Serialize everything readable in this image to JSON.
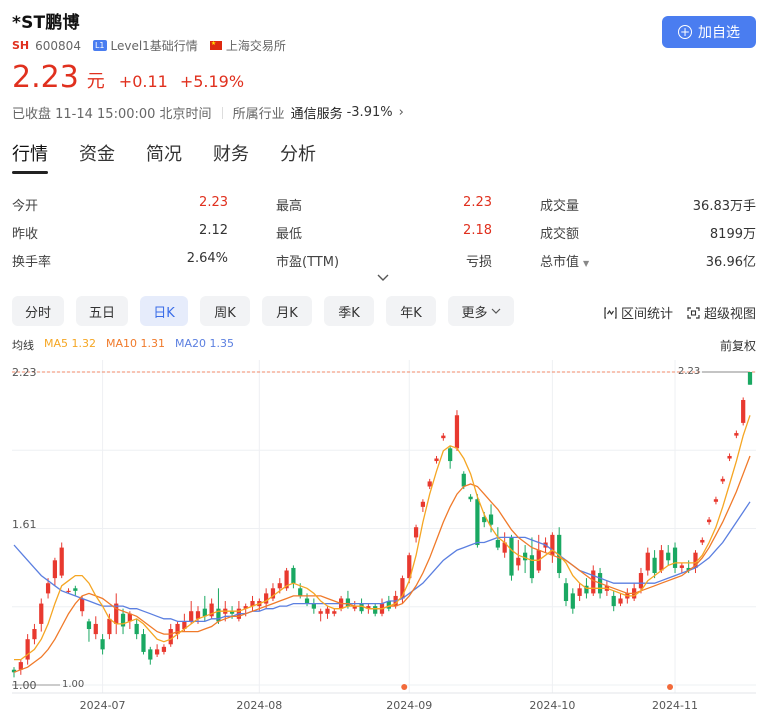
{
  "stock": {
    "name": "*ST鹏博",
    "exchange_badge": "SH",
    "code": "600804",
    "level_badge": "L1",
    "level_text": "Level1基础行情",
    "exchange_name": "上海交易所",
    "add_button": "加自选"
  },
  "quote": {
    "price": "2.23",
    "unit": "元",
    "change": "+0.11",
    "change_pct": "+5.19%",
    "status": "已收盘 11-14 15:00:00 北京时间",
    "industry_label": "所属行业",
    "industry_name": "通信服务",
    "industry_pct": "-3.91%"
  },
  "tabs": [
    "行情",
    "资金",
    "简况",
    "财务",
    "分析"
  ],
  "stats": [
    [
      {
        "label": "今开",
        "value": "2.23",
        "red": true
      },
      {
        "label": "最高",
        "value": "2.23",
        "red": true
      },
      {
        "label": "成交量",
        "value": "36.83万手",
        "red": false
      }
    ],
    [
      {
        "label": "昨收",
        "value": "2.12",
        "red": false
      },
      {
        "label": "最低",
        "value": "2.18",
        "red": true
      },
      {
        "label": "成交额",
        "value": "8199万",
        "red": false
      }
    ],
    [
      {
        "label": "换手率",
        "value": "2.64%",
        "red": false
      },
      {
        "label": "市盈(TTM)",
        "value": "亏损",
        "red": false
      },
      {
        "label": "总市值",
        "value": "36.96亿",
        "red": false
      }
    ]
  ],
  "periods": [
    "分时",
    "五日",
    "日K",
    "周K",
    "月K",
    "季K",
    "年K",
    "更多"
  ],
  "active_period": "日K",
  "tools": {
    "range_stats": "区间统计",
    "super_view": "超级视图"
  },
  "ma": {
    "label": "均线",
    "ma5": "MA5 1.32",
    "ma10": "MA10 1.31",
    "ma20": "MA20 1.35",
    "adjust": "前复权"
  },
  "colors": {
    "up": "#e8392f",
    "down": "#1aa862",
    "accent": "#4a7df0",
    "ma5": "#f5a623",
    "ma10": "#f07a2a",
    "ma20": "#5b7fe0"
  },
  "chart_data": {
    "type": "candlestick",
    "y_labels": [
      "2.23",
      "1.61",
      "1.00"
    ],
    "price_tags": [
      "2.23",
      "1.00"
    ],
    "ylim": [
      1.0,
      2.23
    ],
    "x_ticks": [
      {
        "label": "2024-07",
        "index": 13
      },
      {
        "label": "2024-08",
        "index": 36
      },
      {
        "label": "2024-09",
        "index": 58
      },
      {
        "label": "2024-10",
        "index": 79
      },
      {
        "label": "2024-11",
        "index": 97
      }
    ],
    "event_markers": [
      58,
      97
    ],
    "candles": [
      {
        "o": 1.06,
        "c": 1.05,
        "h": 1.07,
        "l": 1.03
      },
      {
        "o": 1.06,
        "c": 1.09,
        "h": 1.1,
        "l": 1.04
      },
      {
        "o": 1.1,
        "c": 1.18,
        "h": 1.2,
        "l": 1.08
      },
      {
        "o": 1.18,
        "c": 1.22,
        "h": 1.24,
        "l": 1.16
      },
      {
        "o": 1.24,
        "c": 1.32,
        "h": 1.34,
        "l": 1.21
      },
      {
        "o": 1.36,
        "c": 1.4,
        "h": 1.42,
        "l": 1.34
      },
      {
        "o": 1.42,
        "c": 1.49,
        "h": 1.5,
        "l": 1.39
      },
      {
        "o": 1.43,
        "c": 1.54,
        "h": 1.56,
        "l": 1.42
      },
      {
        "o": 1.37,
        "c": 1.37,
        "h": 1.38,
        "l": 1.36
      },
      {
        "o": 1.38,
        "c": 1.37,
        "h": 1.39,
        "l": 1.35
      },
      {
        "o": 1.29,
        "c": 1.34,
        "h": 1.35,
        "l": 1.27
      },
      {
        "o": 1.25,
        "c": 1.22,
        "h": 1.26,
        "l": 1.17
      },
      {
        "o": 1.2,
        "c": 1.24,
        "h": 1.27,
        "l": 1.18
      },
      {
        "o": 1.18,
        "c": 1.14,
        "h": 1.2,
        "l": 1.12
      },
      {
        "o": 1.2,
        "c": 1.26,
        "h": 1.28,
        "l": 1.18
      },
      {
        "o": 1.24,
        "c": 1.32,
        "h": 1.36,
        "l": 1.2
      },
      {
        "o": 1.28,
        "c": 1.23,
        "h": 1.3,
        "l": 1.2
      },
      {
        "o": 1.25,
        "c": 1.28,
        "h": 1.29,
        "l": 1.22
      },
      {
        "o": 1.24,
        "c": 1.2,
        "h": 1.26,
        "l": 1.18
      },
      {
        "o": 1.2,
        "c": 1.13,
        "h": 1.22,
        "l": 1.12
      },
      {
        "o": 1.14,
        "c": 1.1,
        "h": 1.15,
        "l": 1.08
      },
      {
        "o": 1.12,
        "c": 1.14,
        "h": 1.16,
        "l": 1.11
      },
      {
        "o": 1.13,
        "c": 1.15,
        "h": 1.16,
        "l": 1.12
      },
      {
        "o": 1.16,
        "c": 1.22,
        "h": 1.24,
        "l": 1.15
      },
      {
        "o": 1.2,
        "c": 1.24,
        "h": 1.25,
        "l": 1.18
      },
      {
        "o": 1.22,
        "c": 1.25,
        "h": 1.28,
        "l": 1.21
      },
      {
        "o": 1.25,
        "c": 1.29,
        "h": 1.33,
        "l": 1.24
      },
      {
        "o": 1.26,
        "c": 1.29,
        "h": 1.31,
        "l": 1.24
      },
      {
        "o": 1.3,
        "c": 1.27,
        "h": 1.35,
        "l": 1.25
      },
      {
        "o": 1.27,
        "c": 1.32,
        "h": 1.34,
        "l": 1.26
      },
      {
        "o": 1.3,
        "c": 1.25,
        "h": 1.38,
        "l": 1.24
      },
      {
        "o": 1.28,
        "c": 1.3,
        "h": 1.33,
        "l": 1.25
      },
      {
        "o": 1.29,
        "c": 1.28,
        "h": 1.31,
        "l": 1.26
      },
      {
        "o": 1.26,
        "c": 1.3,
        "h": 1.33,
        "l": 1.25
      },
      {
        "o": 1.3,
        "c": 1.31,
        "h": 1.32,
        "l": 1.27
      },
      {
        "o": 1.31,
        "c": 1.33,
        "h": 1.35,
        "l": 1.29
      },
      {
        "o": 1.31,
        "c": 1.33,
        "h": 1.34,
        "l": 1.29
      },
      {
        "o": 1.32,
        "c": 1.36,
        "h": 1.38,
        "l": 1.3
      },
      {
        "o": 1.34,
        "c": 1.38,
        "h": 1.4,
        "l": 1.33
      },
      {
        "o": 1.38,
        "c": 1.4,
        "h": 1.42,
        "l": 1.36
      },
      {
        "o": 1.38,
        "c": 1.45,
        "h": 1.46,
        "l": 1.37
      },
      {
        "o": 1.46,
        "c": 1.4,
        "h": 1.47,
        "l": 1.38
      },
      {
        "o": 1.38,
        "c": 1.35,
        "h": 1.4,
        "l": 1.34
      },
      {
        "o": 1.34,
        "c": 1.32,
        "h": 1.36,
        "l": 1.31
      },
      {
        "o": 1.32,
        "c": 1.3,
        "h": 1.34,
        "l": 1.28
      },
      {
        "o": 1.28,
        "c": 1.29,
        "h": 1.3,
        "l": 1.25
      },
      {
        "o": 1.28,
        "c": 1.3,
        "h": 1.31,
        "l": 1.26
      },
      {
        "o": 1.28,
        "c": 1.29,
        "h": 1.3,
        "l": 1.27
      },
      {
        "o": 1.3,
        "c": 1.34,
        "h": 1.35,
        "l": 1.29
      },
      {
        "o": 1.34,
        "c": 1.31,
        "h": 1.37,
        "l": 1.3
      },
      {
        "o": 1.3,
        "c": 1.31,
        "h": 1.33,
        "l": 1.29
      },
      {
        "o": 1.32,
        "c": 1.29,
        "h": 1.34,
        "l": 1.28
      },
      {
        "o": 1.3,
        "c": 1.31,
        "h": 1.32,
        "l": 1.28
      },
      {
        "o": 1.31,
        "c": 1.28,
        "h": 1.32,
        "l": 1.27
      },
      {
        "o": 1.28,
        "c": 1.32,
        "h": 1.34,
        "l": 1.27
      },
      {
        "o": 1.33,
        "c": 1.3,
        "h": 1.35,
        "l": 1.29
      },
      {
        "o": 1.31,
        "c": 1.35,
        "h": 1.37,
        "l": 1.3
      },
      {
        "o": 1.34,
        "c": 1.42,
        "h": 1.43,
        "l": 1.32
      },
      {
        "o": 1.42,
        "c": 1.51,
        "h": 1.52,
        "l": 1.4
      },
      {
        "o": 1.58,
        "c": 1.62,
        "h": 1.63,
        "l": 1.56
      },
      {
        "o": 1.7,
        "c": 1.72,
        "h": 1.73,
        "l": 1.68
      },
      {
        "o": 1.78,
        "c": 1.8,
        "h": 1.81,
        "l": 1.77
      },
      {
        "o": 1.88,
        "c": 1.89,
        "h": 1.9,
        "l": 1.87
      },
      {
        "o": 1.97,
        "c": 1.98,
        "h": 1.99,
        "l": 1.96
      },
      {
        "o": 1.93,
        "c": 1.88,
        "h": 1.94,
        "l": 1.85
      },
      {
        "o": 1.93,
        "c": 2.06,
        "h": 2.08,
        "l": 1.92
      },
      {
        "o": 1.83,
        "c": 1.78,
        "h": 1.84,
        "l": 1.77
      },
      {
        "o": 1.74,
        "c": 1.73,
        "h": 1.75,
        "l": 1.72
      },
      {
        "o": 1.73,
        "c": 1.55,
        "h": 1.75,
        "l": 1.54
      },
      {
        "o": 1.66,
        "c": 1.64,
        "h": 1.68,
        "l": 1.62
      },
      {
        "o": 1.67,
        "c": 1.63,
        "h": 1.71,
        "l": 1.6
      },
      {
        "o": 1.57,
        "c": 1.54,
        "h": 1.62,
        "l": 1.53
      },
      {
        "o": 1.52,
        "c": 1.56,
        "h": 1.6,
        "l": 1.5
      },
      {
        "o": 1.58,
        "c": 1.43,
        "h": 1.59,
        "l": 1.41
      },
      {
        "o": 1.47,
        "c": 1.5,
        "h": 1.57,
        "l": 1.45
      },
      {
        "o": 1.52,
        "c": 1.49,
        "h": 1.55,
        "l": 1.44
      },
      {
        "o": 1.51,
        "c": 1.42,
        "h": 1.58,
        "l": 1.4
      },
      {
        "o": 1.45,
        "c": 1.53,
        "h": 1.59,
        "l": 1.44
      },
      {
        "o": 1.54,
        "c": 1.56,
        "h": 1.58,
        "l": 1.52
      },
      {
        "o": 1.51,
        "c": 1.59,
        "h": 1.6,
        "l": 1.48
      },
      {
        "o": 1.59,
        "c": 1.44,
        "h": 1.62,
        "l": 1.42
      },
      {
        "o": 1.4,
        "c": 1.33,
        "h": 1.42,
        "l": 1.31
      },
      {
        "o": 1.36,
        "c": 1.3,
        "h": 1.38,
        "l": 1.28
      },
      {
        "o": 1.35,
        "c": 1.38,
        "h": 1.4,
        "l": 1.33
      },
      {
        "o": 1.39,
        "c": 1.36,
        "h": 1.42,
        "l": 1.34
      },
      {
        "o": 1.36,
        "c": 1.45,
        "h": 1.47,
        "l": 1.35
      },
      {
        "o": 1.44,
        "c": 1.36,
        "h": 1.46,
        "l": 1.34
      },
      {
        "o": 1.37,
        "c": 1.39,
        "h": 1.41,
        "l": 1.35
      },
      {
        "o": 1.35,
        "c": 1.31,
        "h": 1.37,
        "l": 1.29
      },
      {
        "o": 1.32,
        "c": 1.34,
        "h": 1.36,
        "l": 1.31
      },
      {
        "o": 1.34,
        "c": 1.36,
        "h": 1.38,
        "l": 1.32
      },
      {
        "o": 1.34,
        "c": 1.38,
        "h": 1.4,
        "l": 1.33
      },
      {
        "o": 1.38,
        "c": 1.44,
        "h": 1.46,
        "l": 1.36
      },
      {
        "o": 1.45,
        "c": 1.52,
        "h": 1.54,
        "l": 1.43
      },
      {
        "o": 1.5,
        "c": 1.44,
        "h": 1.53,
        "l": 1.42
      },
      {
        "o": 1.45,
        "c": 1.53,
        "h": 1.55,
        "l": 1.44
      },
      {
        "o": 1.52,
        "c": 1.49,
        "h": 1.55,
        "l": 1.47
      },
      {
        "o": 1.54,
        "c": 1.46,
        "h": 1.56,
        "l": 1.44
      },
      {
        "o": 1.46,
        "c": 1.47,
        "h": 1.48,
        "l": 1.44
      },
      {
        "o": 1.46,
        "c": 1.45,
        "h": 1.49,
        "l": 1.44
      },
      {
        "o": 1.46,
        "c": 1.52,
        "h": 1.53,
        "l": 1.44
      },
      {
        "o": 1.56,
        "c": 1.57,
        "h": 1.58,
        "l": 1.55
      },
      {
        "o": 1.64,
        "c": 1.65,
        "h": 1.66,
        "l": 1.63
      },
      {
        "o": 1.72,
        "c": 1.73,
        "h": 1.74,
        "l": 1.71
      },
      {
        "o": 1.8,
        "c": 1.81,
        "h": 1.82,
        "l": 1.79
      },
      {
        "o": 1.89,
        "c": 1.9,
        "h": 1.91,
        "l": 1.88
      },
      {
        "o": 1.98,
        "c": 1.99,
        "h": 2.0,
        "l": 1.97
      },
      {
        "o": 2.03,
        "c": 2.12,
        "h": 2.13,
        "l": 2.02
      },
      {
        "o": 2.23,
        "c": 2.18,
        "h": 2.23,
        "l": 2.18
      }
    ],
    "ma5": [
      1.1,
      1.1,
      1.12,
      1.14,
      1.18,
      1.24,
      1.32,
      1.39,
      1.41,
      1.43,
      1.43,
      1.4,
      1.35,
      1.31,
      1.26,
      1.24,
      1.24,
      1.25,
      1.26,
      1.24,
      1.21,
      1.18,
      1.17,
      1.18,
      1.2,
      1.22,
      1.24,
      1.26,
      1.27,
      1.28,
      1.29,
      1.29,
      1.29,
      1.29,
      1.3,
      1.31,
      1.32,
      1.33,
      1.35,
      1.37,
      1.39,
      1.4,
      1.39,
      1.38,
      1.36,
      1.33,
      1.31,
      1.3,
      1.3,
      1.31,
      1.31,
      1.31,
      1.3,
      1.3,
      1.3,
      1.31,
      1.32,
      1.35,
      1.41,
      1.51,
      1.64,
      1.75,
      1.84,
      1.92,
      1.94,
      1.93,
      1.89,
      1.83,
      1.74,
      1.67,
      1.62,
      1.58,
      1.56,
      1.53,
      1.51,
      1.5,
      1.49,
      1.49,
      1.51,
      1.53,
      1.51,
      1.48,
      1.43,
      1.4,
      1.38,
      1.38,
      1.38,
      1.38,
      1.37,
      1.36,
      1.35,
      1.35,
      1.37,
      1.41,
      1.43,
      1.45,
      1.47,
      1.48,
      1.48,
      1.48,
      1.48,
      1.51,
      1.56,
      1.62,
      1.7,
      1.79,
      1.88,
      1.98,
      2.06
    ],
    "ma10": [
      1.05,
      1.06,
      1.07,
      1.09,
      1.11,
      1.14,
      1.18,
      1.23,
      1.28,
      1.32,
      1.35,
      1.36,
      1.35,
      1.34,
      1.32,
      1.3,
      1.29,
      1.28,
      1.27,
      1.25,
      1.23,
      1.21,
      1.2,
      1.2,
      1.21,
      1.21,
      1.21,
      1.21,
      1.22,
      1.23,
      1.25,
      1.26,
      1.27,
      1.27,
      1.28,
      1.29,
      1.3,
      1.31,
      1.32,
      1.33,
      1.34,
      1.35,
      1.35,
      1.35,
      1.35,
      1.35,
      1.34,
      1.33,
      1.32,
      1.32,
      1.31,
      1.31,
      1.3,
      1.3,
      1.3,
      1.31,
      1.31,
      1.32,
      1.35,
      1.39,
      1.44,
      1.5,
      1.57,
      1.64,
      1.7,
      1.75,
      1.78,
      1.79,
      1.78,
      1.75,
      1.72,
      1.69,
      1.65,
      1.61,
      1.58,
      1.56,
      1.54,
      1.53,
      1.52,
      1.51,
      1.5,
      1.49,
      1.47,
      1.45,
      1.43,
      1.41,
      1.4,
      1.39,
      1.38,
      1.37,
      1.36,
      1.36,
      1.37,
      1.38,
      1.39,
      1.4,
      1.41,
      1.42,
      1.43,
      1.45,
      1.47,
      1.5,
      1.54,
      1.59,
      1.64,
      1.7,
      1.76,
      1.83,
      1.9
    ],
    "ma20": [
      1.55,
      1.52,
      1.49,
      1.46,
      1.43,
      1.41,
      1.39,
      1.37,
      1.36,
      1.35,
      1.34,
      1.33,
      1.32,
      1.31,
      1.31,
      1.31,
      1.31,
      1.3,
      1.3,
      1.29,
      1.28,
      1.27,
      1.26,
      1.26,
      1.25,
      1.25,
      1.25,
      1.25,
      1.25,
      1.26,
      1.26,
      1.27,
      1.27,
      1.28,
      1.28,
      1.29,
      1.29,
      1.3,
      1.3,
      1.31,
      1.31,
      1.32,
      1.32,
      1.32,
      1.32,
      1.32,
      1.32,
      1.32,
      1.32,
      1.32,
      1.32,
      1.32,
      1.32,
      1.32,
      1.32,
      1.33,
      1.33,
      1.34,
      1.36,
      1.38,
      1.4,
      1.43,
      1.46,
      1.49,
      1.51,
      1.53,
      1.54,
      1.55,
      1.56,
      1.56,
      1.57,
      1.58,
      1.58,
      1.58,
      1.58,
      1.58,
      1.57,
      1.56,
      1.55,
      1.53,
      1.51,
      1.49,
      1.47,
      1.45,
      1.44,
      1.43,
      1.42,
      1.41,
      1.4,
      1.4,
      1.4,
      1.4,
      1.4,
      1.4,
      1.4,
      1.41,
      1.42,
      1.43,
      1.44,
      1.45,
      1.46,
      1.48,
      1.5,
      1.53,
      1.56,
      1.6,
      1.64,
      1.68,
      1.72
    ]
  }
}
